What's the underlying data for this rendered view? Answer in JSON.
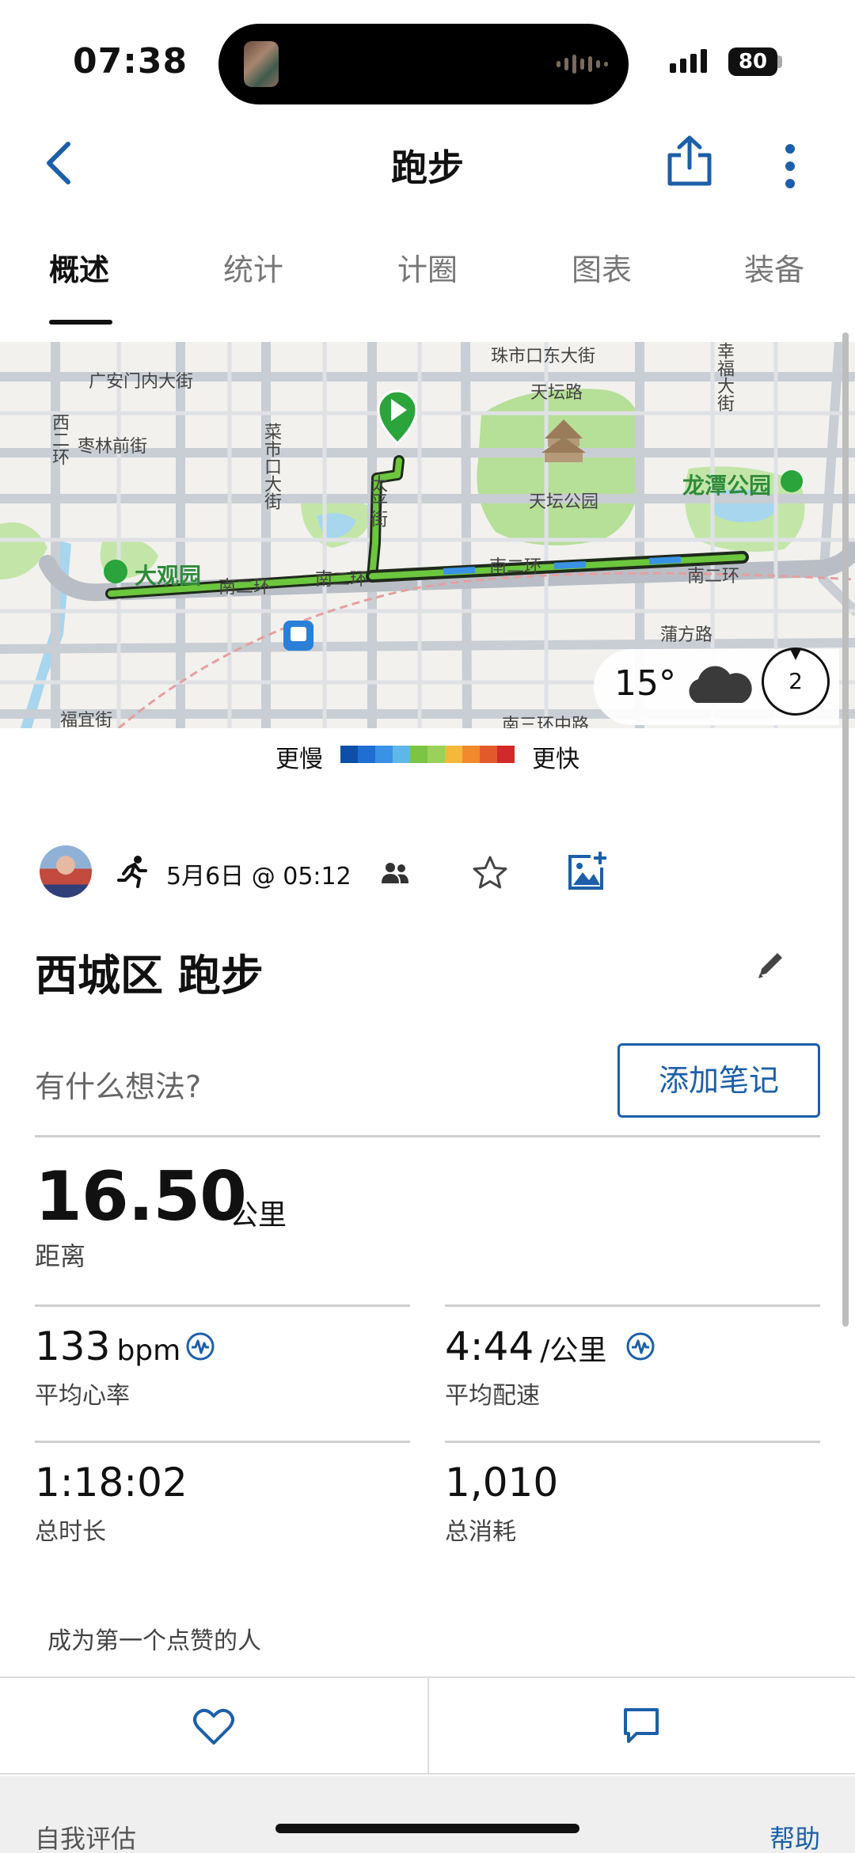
{
  "status_bar": {
    "time": "07:38",
    "battery": "80"
  },
  "nav": {
    "title": "跑步"
  },
  "tabs": [
    {
      "label": "概述",
      "active": true
    },
    {
      "label": "统计",
      "active": false
    },
    {
      "label": "计圈",
      "active": false
    },
    {
      "label": "图表",
      "active": false
    },
    {
      "label": "装备",
      "active": false
    }
  ],
  "map": {
    "labels": {
      "l1": "广安门内大街",
      "l2": "枣林前街",
      "l3": "菜市口大街",
      "l4": "天坛路",
      "l5": "天坛公园",
      "l6": "龙潭公园",
      "l7": "大观园",
      "l8": "南二环",
      "l9": "南二环",
      "l10": "南二环",
      "l11": "南二环",
      "l12": "蒲方路",
      "l13": "太平街",
      "l14": "幸福大街",
      "l15": "西二环",
      "l16": "福宜街",
      "l17": "南三环中路",
      "l18": "珠市口东大街"
    },
    "weather_temp": "15°",
    "compass_number": "2",
    "legend_slow": "更慢",
    "legend_fast": "更快",
    "legend_colors": [
      "#0d4fa8",
      "#1e6fd1",
      "#3a92e6",
      "#5fb6e8",
      "#7cc443",
      "#9bd15a",
      "#f5b83a",
      "#f08a2c",
      "#e25a2a",
      "#d22a2a"
    ]
  },
  "activity": {
    "date": "5月6日 @ 05:12",
    "title": "西城区 跑步",
    "note_placeholder": "有什么想法?",
    "note_button": "添加笔记",
    "distance_value": "16.50",
    "distance_unit": "公里",
    "distance_label": "距离",
    "heart_rate_value": "133",
    "heart_rate_unit": "bpm",
    "heart_rate_label": "平均心率",
    "pace_value": "4:44",
    "pace_unit": "/公里",
    "pace_label": "平均配速",
    "duration_value": "1:18:02",
    "duration_label": "总时长",
    "calories_value": "1,010",
    "calories_label": "总消耗",
    "kudos_text": "成为第一个点赞的人"
  },
  "footer": {
    "left": "自我评估",
    "right": "帮助"
  },
  "colors": {
    "accent": "#1c5fa8",
    "route": "#2f7d2a",
    "park": "#b6df97"
  }
}
